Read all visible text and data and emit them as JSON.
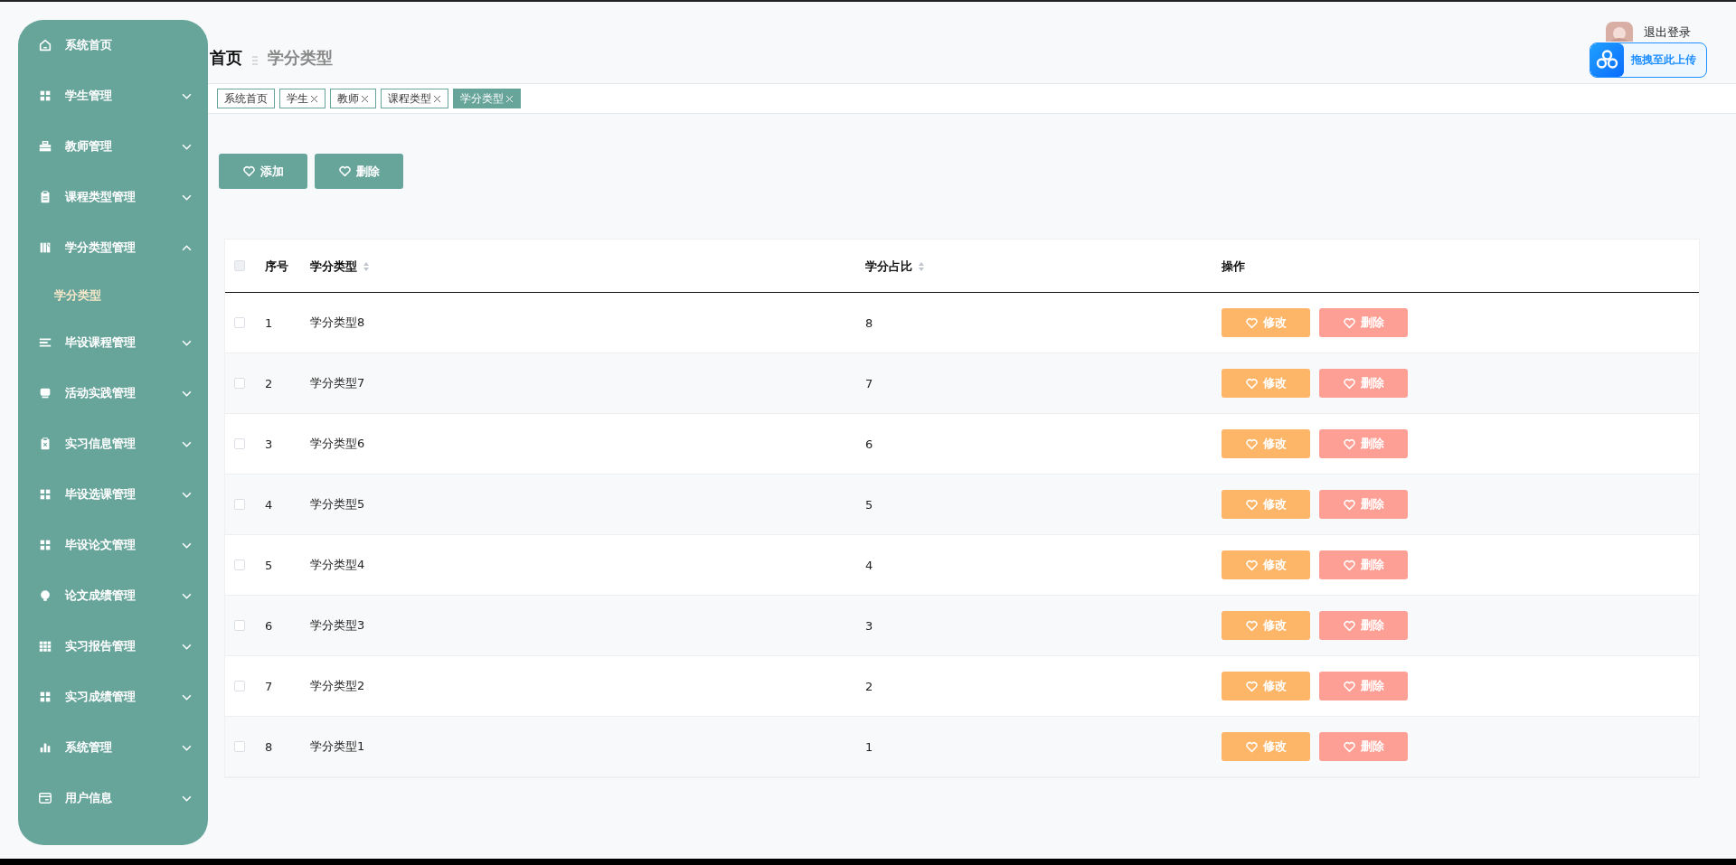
{
  "sidebar": {
    "items": [
      {
        "label": "系统首页",
        "kind": "link"
      },
      {
        "label": "学生管理",
        "kind": "menu",
        "expanded": false
      },
      {
        "label": "教师管理",
        "kind": "menu",
        "expanded": false
      },
      {
        "label": "课程类型管理",
        "kind": "menu",
        "expanded": false
      },
      {
        "label": "学分类型管理",
        "kind": "menu",
        "expanded": true,
        "children": [
          {
            "label": "学分类型",
            "selected": true
          }
        ]
      },
      {
        "label": "毕设课程管理",
        "kind": "menu",
        "expanded": false
      },
      {
        "label": "活动实践管理",
        "kind": "menu",
        "expanded": false
      },
      {
        "label": "实习信息管理",
        "kind": "menu",
        "expanded": false
      },
      {
        "label": "毕设选课管理",
        "kind": "menu",
        "expanded": false
      },
      {
        "label": "毕设论文管理",
        "kind": "menu",
        "expanded": false
      },
      {
        "label": "论文成绩管理",
        "kind": "menu",
        "expanded": false
      },
      {
        "label": "实习报告管理",
        "kind": "menu",
        "expanded": false
      },
      {
        "label": "实习成绩管理",
        "kind": "menu",
        "expanded": false
      },
      {
        "label": "系统管理",
        "kind": "menu",
        "expanded": false
      },
      {
        "label": "用户信息",
        "kind": "menu",
        "expanded": false
      }
    ]
  },
  "header": {
    "breadcrumb": [
      {
        "label": "首页"
      },
      {
        "label": "学分类型"
      }
    ],
    "logout": "退出登录",
    "upload_widget": "拖拽至此上传"
  },
  "tabs": [
    {
      "label": "系统首页",
      "closable": false,
      "selected": false
    },
    {
      "label": "学生",
      "closable": true,
      "selected": false
    },
    {
      "label": "教师",
      "closable": true,
      "selected": false
    },
    {
      "label": "课程类型",
      "closable": true,
      "selected": false
    },
    {
      "label": "学分类型",
      "closable": true,
      "selected": true
    }
  ],
  "toolbar": [
    {
      "label": "添加"
    },
    {
      "label": "删除"
    }
  ],
  "table": {
    "select_all": {
      "checked": false
    },
    "columns": [
      {
        "label": "序号",
        "sortable": false
      },
      {
        "label": "学分类型",
        "sortable": true
      },
      {
        "label": "学分占比",
        "sortable": true
      },
      {
        "label": "操作",
        "sortable": false
      }
    ],
    "rows": [
      {
        "index": "1",
        "name": "学分类型8",
        "ratio": "8",
        "checked": false,
        "actions": [
          {
            "label": "修改",
            "kind": "edit"
          },
          {
            "label": "删除",
            "kind": "delete"
          }
        ]
      },
      {
        "index": "2",
        "name": "学分类型7",
        "ratio": "7",
        "checked": false,
        "actions": [
          {
            "label": "修改",
            "kind": "edit"
          },
          {
            "label": "删除",
            "kind": "delete"
          }
        ]
      },
      {
        "index": "3",
        "name": "学分类型6",
        "ratio": "6",
        "checked": false,
        "actions": [
          {
            "label": "修改",
            "kind": "edit"
          },
          {
            "label": "删除",
            "kind": "delete"
          }
        ]
      },
      {
        "index": "4",
        "name": "学分类型5",
        "ratio": "5",
        "checked": false,
        "actions": [
          {
            "label": "修改",
            "kind": "edit"
          },
          {
            "label": "删除",
            "kind": "delete"
          }
        ]
      },
      {
        "index": "5",
        "name": "学分类型4",
        "ratio": "4",
        "checked": false,
        "actions": [
          {
            "label": "修改",
            "kind": "edit"
          },
          {
            "label": "删除",
            "kind": "delete"
          }
        ]
      },
      {
        "index": "6",
        "name": "学分类型3",
        "ratio": "3",
        "checked": false,
        "actions": [
          {
            "label": "修改",
            "kind": "edit"
          },
          {
            "label": "删除",
            "kind": "delete"
          }
        ]
      },
      {
        "index": "7",
        "name": "学分类型2",
        "ratio": "2",
        "checked": false,
        "actions": [
          {
            "label": "修改",
            "kind": "edit"
          },
          {
            "label": "删除",
            "kind": "delete"
          }
        ]
      },
      {
        "index": "8",
        "name": "学分类型1",
        "ratio": "1",
        "checked": false,
        "actions": [
          {
            "label": "修改",
            "kind": "edit"
          },
          {
            "label": "删除",
            "kind": "delete"
          }
        ]
      }
    ]
  }
}
